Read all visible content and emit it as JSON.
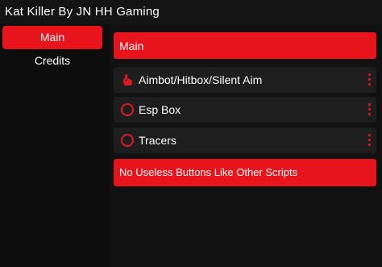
{
  "window": {
    "title": "Kat Killer By JN HH Gaming"
  },
  "sidebar": {
    "items": [
      {
        "label": "Main",
        "active": true
      },
      {
        "label": "Credits",
        "active": false
      }
    ]
  },
  "main": {
    "section_title": "Main",
    "options": [
      {
        "label": "Aimbot/Hitbox/Silent Aim",
        "icon": "hand-pointer-icon"
      },
      {
        "label": "Esp Box",
        "icon": "circle-outline-icon"
      },
      {
        "label": "Tracers",
        "icon": "circle-outline-icon"
      }
    ],
    "footer_button": "No Useless Buttons Like Other Scripts"
  },
  "colors": {
    "accent": "#e8141c",
    "background": "#0b0b0b",
    "row": "#1e1e1e"
  }
}
